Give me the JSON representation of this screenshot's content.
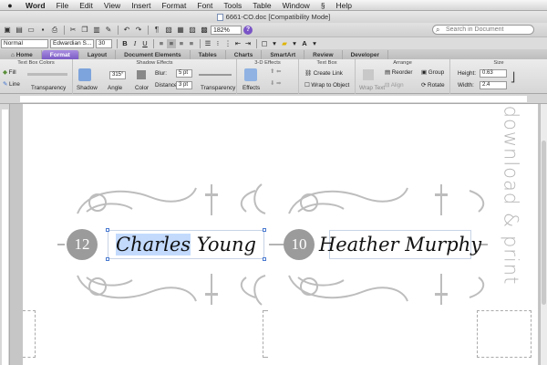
{
  "menubar": {
    "apple": "",
    "app": "Word",
    "items": [
      "File",
      "Edit",
      "View",
      "Insert",
      "Format",
      "Font",
      "Tools",
      "Table",
      "Window",
      "",
      "Help"
    ]
  },
  "window": {
    "title": "6661-CO.doc [Compatibility Mode]"
  },
  "toolbar": {
    "zoom": "182%",
    "search_placeholder": "Search in Document"
  },
  "formatting": {
    "style": "Normal",
    "font": "Edwardian S...",
    "size": "30"
  },
  "tabs": [
    "Home",
    "Format",
    "Layout",
    "Document Elements",
    "Tables",
    "Charts",
    "SmartArt",
    "Review",
    "Developer"
  ],
  "ribbon": {
    "groups": {
      "text_box_colors": "Text Box Colors",
      "shadow_effects": "Shadow Effects",
      "effects_3d": "3-D Effects",
      "text_box": "Text Box",
      "arrange": "Arrange",
      "size": "Size"
    },
    "fill": "Fill",
    "line": "Line",
    "transparency": "Transparency",
    "shadow": "Shadow",
    "angle": "Angle",
    "angle_value": "315°",
    "color": "Color",
    "blur": "Blur:",
    "blur_value": "5 pt",
    "distance": "Distance:",
    "distance_value": "3 pt",
    "transparency2": "Transparency",
    "effects": "Effects",
    "create_link": "Create Link",
    "wrap_to_object": "Wrap to Object",
    "wrap_text": "Wrap Text",
    "reorder": "Reorder",
    "group": "Group",
    "align": "Align",
    "rotate": "Rotate",
    "height_label": "Height:",
    "height_value": "0.63",
    "width_label": "Width:",
    "width_value": "2.4"
  },
  "cards": [
    {
      "number": "12",
      "first": "Charles",
      "last": "Young"
    },
    {
      "number": "10",
      "name": "Heather Murphy"
    }
  ],
  "sidebar_text": {
    "text": "download & print"
  },
  "colors": {
    "accent": "#7b5cc4",
    "selection": "#c3dafd",
    "badge": "#9b9b9b",
    "ornament": "#bdbdbd"
  }
}
